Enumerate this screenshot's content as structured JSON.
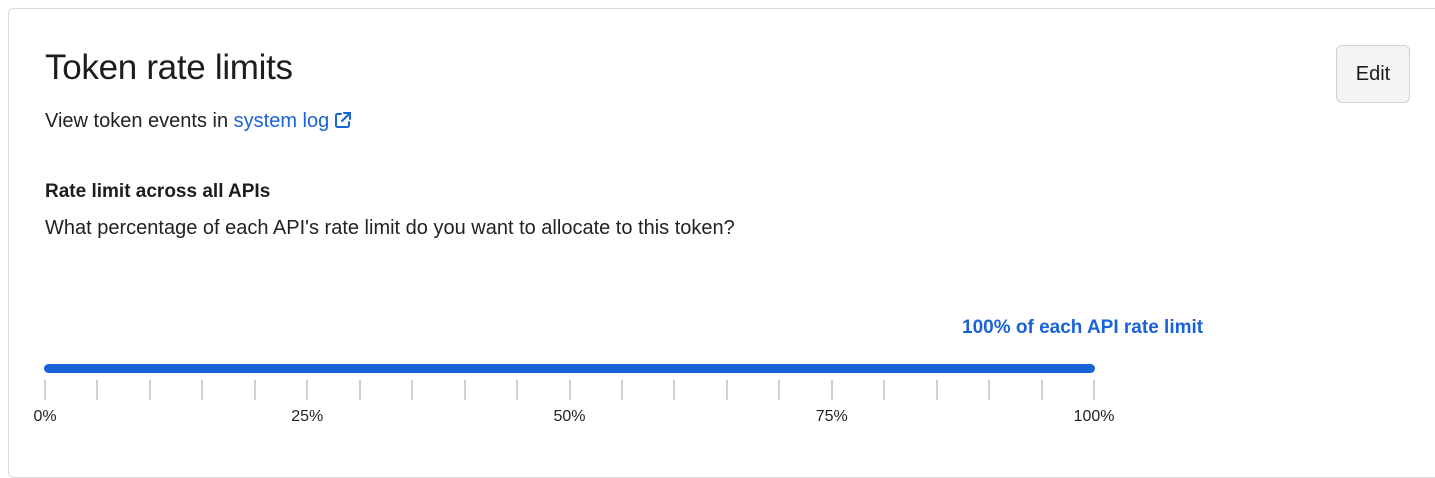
{
  "header": {
    "title": "Token rate limits",
    "edit_label": "Edit"
  },
  "subline": {
    "prefix": "View token events in ",
    "link_text": "system log",
    "link_icon": "external-link-icon"
  },
  "rate_limit": {
    "heading": "Rate limit across all APIs",
    "description": "What percentage of each API's rate limit do you want to allocate to this token?",
    "value_label": "100% of each API rate limit",
    "value_percent": 100,
    "tick_count": 21,
    "tick_labels": [
      "0%",
      "25%",
      "50%",
      "75%",
      "100%"
    ]
  },
  "colors": {
    "accent": "#1a63d6",
    "track": "#d6d6d6",
    "tick": "#d0d0d0"
  }
}
